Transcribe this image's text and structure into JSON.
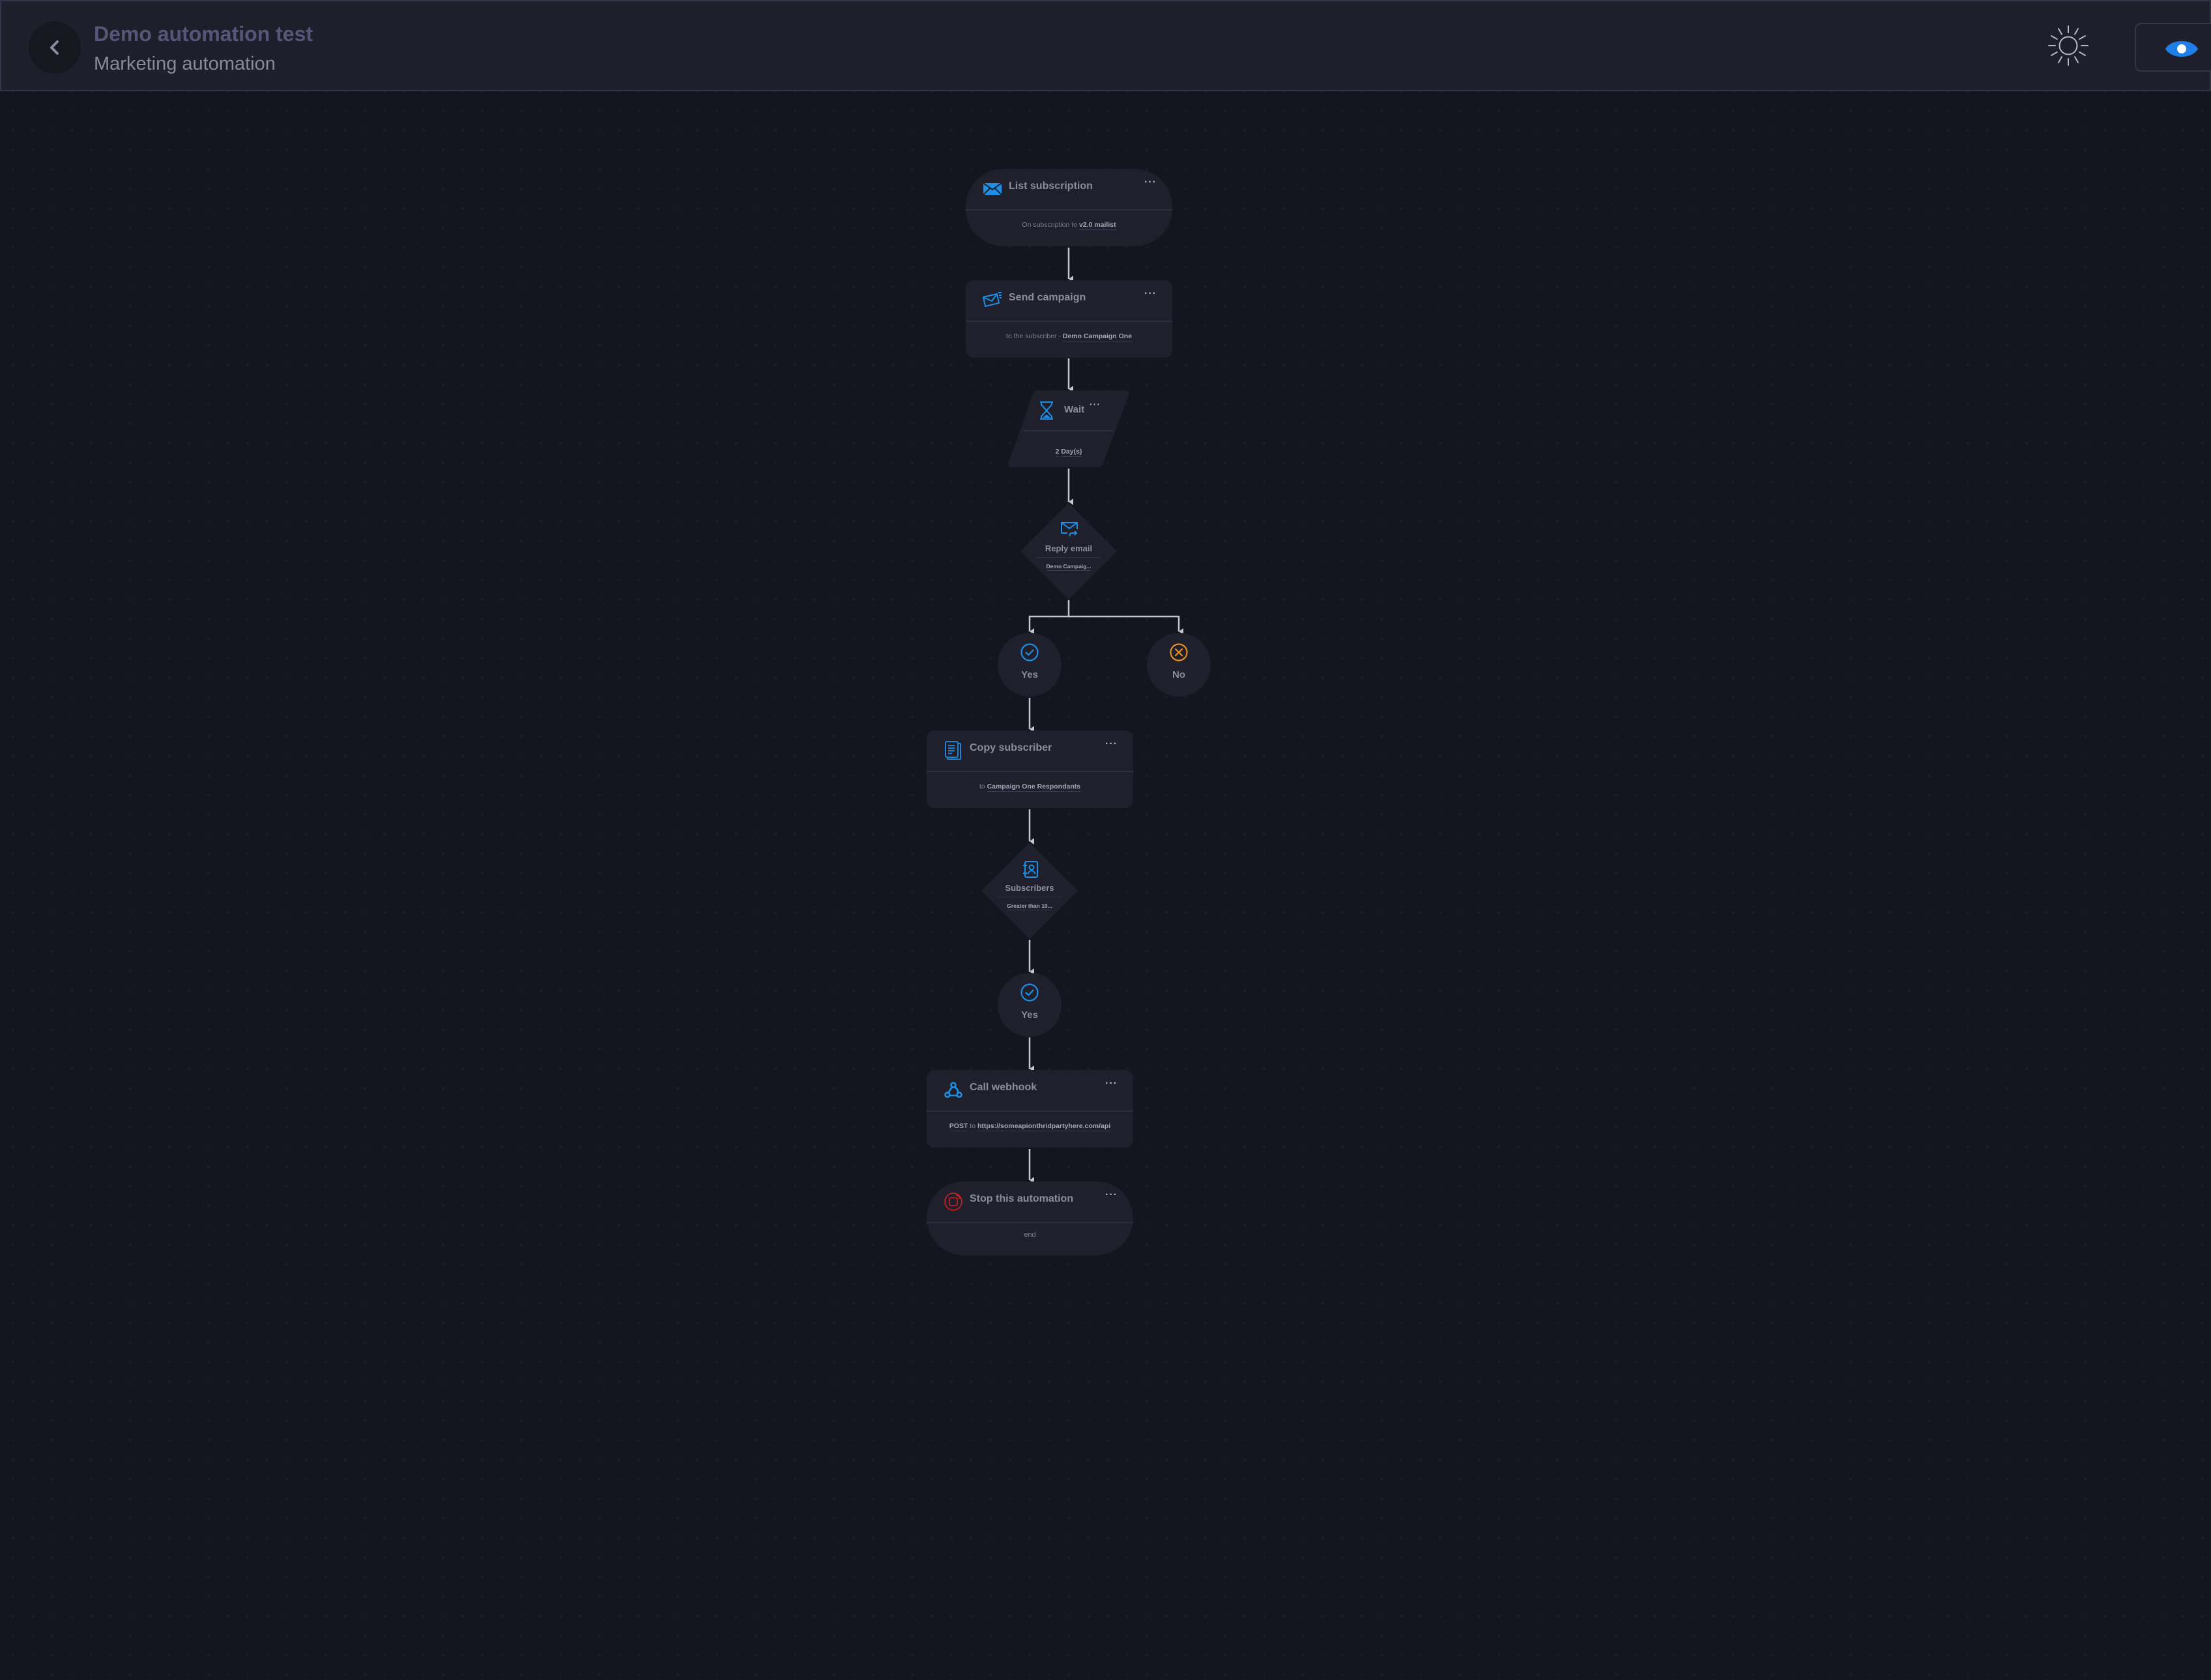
{
  "header": {
    "title": "Demo automation test",
    "subtitle": "Marketing automation",
    "back_icon": "chevron-left-icon",
    "theme_icon": "sun-icon",
    "preview_icon": "eye-icon"
  },
  "colors": {
    "accent": "#1c8fe6",
    "no_branch": "#e8901c",
    "stop": "#d11f22",
    "preview": "#1f7fe6"
  },
  "flow": {
    "list_subscription": {
      "icon": "envelope-icon",
      "title": "List subscription",
      "menu": "···",
      "body_prefix": "On subscription to ",
      "body_value": "v2.0 mailist"
    },
    "send_campaign": {
      "icon": "send-mail-icon",
      "title": "Send campaign",
      "menu": "···",
      "body_prefix": "to the subscriber - ",
      "body_value": "Demo Campaign One"
    },
    "wait": {
      "icon": "hourglass-icon",
      "title": "Wait",
      "menu": "···",
      "amount": "2",
      "unit": "Day(s)"
    },
    "reply_email": {
      "icon": "reply-mail-icon",
      "title": "Reply email",
      "value": "Demo Campaig..."
    },
    "reply_branches": {
      "yes": {
        "icon": "check-circle-icon",
        "label": "Yes"
      },
      "no": {
        "icon": "x-circle-icon",
        "label": "No"
      }
    },
    "copy_subscriber": {
      "icon": "copy-document-icon",
      "title": "Copy subscriber",
      "menu": "···",
      "body_prefix": "to ",
      "body_value": "Campaign One Respondants"
    },
    "subscribers": {
      "icon": "contact-book-icon",
      "title": "Subscribers",
      "operator": "Greater than",
      "value": "10..."
    },
    "subscribers_branch": {
      "yes": {
        "icon": "check-circle-icon",
        "label": "Yes"
      }
    },
    "call_webhook": {
      "icon": "webhook-icon",
      "title": "Call webhook",
      "menu": "···",
      "method": "POST",
      "body_mid": " to ",
      "url": "https://someapionthridpartyhere.com/api"
    },
    "stop": {
      "icon": "stop-icon",
      "title": "Stop this automation",
      "menu": "···",
      "body": "end"
    }
  }
}
